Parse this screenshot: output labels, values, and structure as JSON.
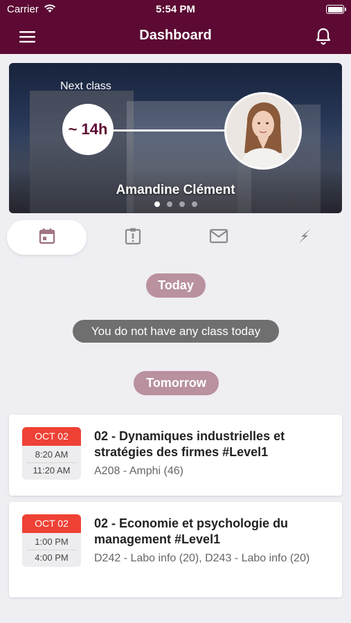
{
  "status": {
    "carrier": "Carrier",
    "time": "5:54 PM"
  },
  "header": {
    "title": "Dashboard"
  },
  "hero": {
    "label": "Next class",
    "time_until": "~ 14h",
    "teacher": "Amandine Clément",
    "pages": 4,
    "active_page": 0
  },
  "tabs": [
    {
      "name": "calendar",
      "icon": "calendar-icon",
      "active": true
    },
    {
      "name": "alerts",
      "icon": "clipboard-alert-icon",
      "active": false
    },
    {
      "name": "messages",
      "icon": "mail-icon",
      "active": false
    },
    {
      "name": "activity",
      "icon": "bolt-icon",
      "active": false
    }
  ],
  "schedule": {
    "today_label": "Today",
    "no_class": "You do not have any class today",
    "tomorrow_label": "Tomorrow",
    "classes": [
      {
        "month": "OCT 02",
        "start": "8:20 AM",
        "end": "11:20 AM",
        "title": "02 - Dynamiques industrielles et stratégies des firmes #Level1",
        "room": "A208 - Amphi (46)"
      },
      {
        "month": "OCT 02",
        "start": "1:00 PM",
        "end": "4:00 PM",
        "title": "02 - Economie et psychologie du management #Level1",
        "room": "D242 - Labo info (20), D243 - Labo info (20)"
      }
    ]
  },
  "colors": {
    "brand": "#5C0A33",
    "pill": "#B9919F",
    "date_accent": "#EF4135",
    "message": "#6F6F6F"
  }
}
